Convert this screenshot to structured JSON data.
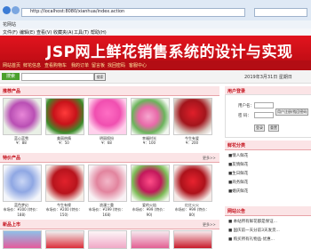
{
  "browser": {
    "url": "http://localhost:8080/xianhua/index.action",
    "tab_title": "花网站",
    "menu": [
      "文件(F)",
      "编辑(E)",
      "查看(V)",
      "收藏夹(A)",
      "工具(T)",
      "帮助(H)"
    ]
  },
  "banner": {
    "title": "JSP网上鲜花销售系统的设计与实现"
  },
  "nav": {
    "items": [
      "网站首页",
      "鲜花信息",
      "查看购物车",
      "我的订单",
      "留言板",
      "找回密码",
      "客服中心"
    ]
  },
  "search": {
    "badge": "搜索",
    "button": "搜索",
    "date": "2019年3月31日 星期日"
  },
  "sections": {
    "featured": {
      "title": "推荐产品"
    },
    "specials": {
      "title": "特价产品",
      "more": "更多>>"
    },
    "latest": {
      "title": "新品上市",
      "more": "更多>>"
    }
  },
  "featured_products": [
    {
      "name": "蓝心蓝雪",
      "price": "¥：88"
    },
    {
      "name": "美丽热情",
      "price": "¥：50"
    },
    {
      "name": "明丽缤纷",
      "price": "¥：68"
    },
    {
      "name": "幸福时光",
      "price": "¥：100"
    },
    {
      "name": "今生有爱",
      "price": "¥：200"
    }
  ],
  "special_products": [
    {
      "name": "蓝色梦幻",
      "price": "市场价：¥300 (特价：188)"
    },
    {
      "name": "今生有缘",
      "price": "市场价：¥200 (特价：150)"
    },
    {
      "name": "浪漫三重",
      "price": "市场价：¥199 (特价：168)"
    },
    {
      "name": "爱的火焰",
      "price": "市场价：¥99 (特价：90)"
    },
    {
      "name": "红红火火",
      "price": "市场价：¥99 (特价：80)"
    }
  ],
  "side": {
    "login": {
      "title": "用户登录",
      "user_label": "用户名：",
      "pass_label": "密 码：",
      "register": "用户注册/找回密码",
      "login_btn": "登录",
      "reset_btn": "重置"
    },
    "categories": {
      "title": "鲜花分类",
      "items": [
        "■情人鲜花",
        "■友情鲜花",
        "■生日鲜花",
        "■商务鲜花",
        "■婚庆鲜花"
      ]
    },
    "news": {
      "title": "网站公告",
      "items": [
        "■ 本站所有鲜花都是保证...",
        "■ 国庆前一天分前3天发货...",
        "■ 购买所有礼物品·优惠..."
      ]
    }
  }
}
